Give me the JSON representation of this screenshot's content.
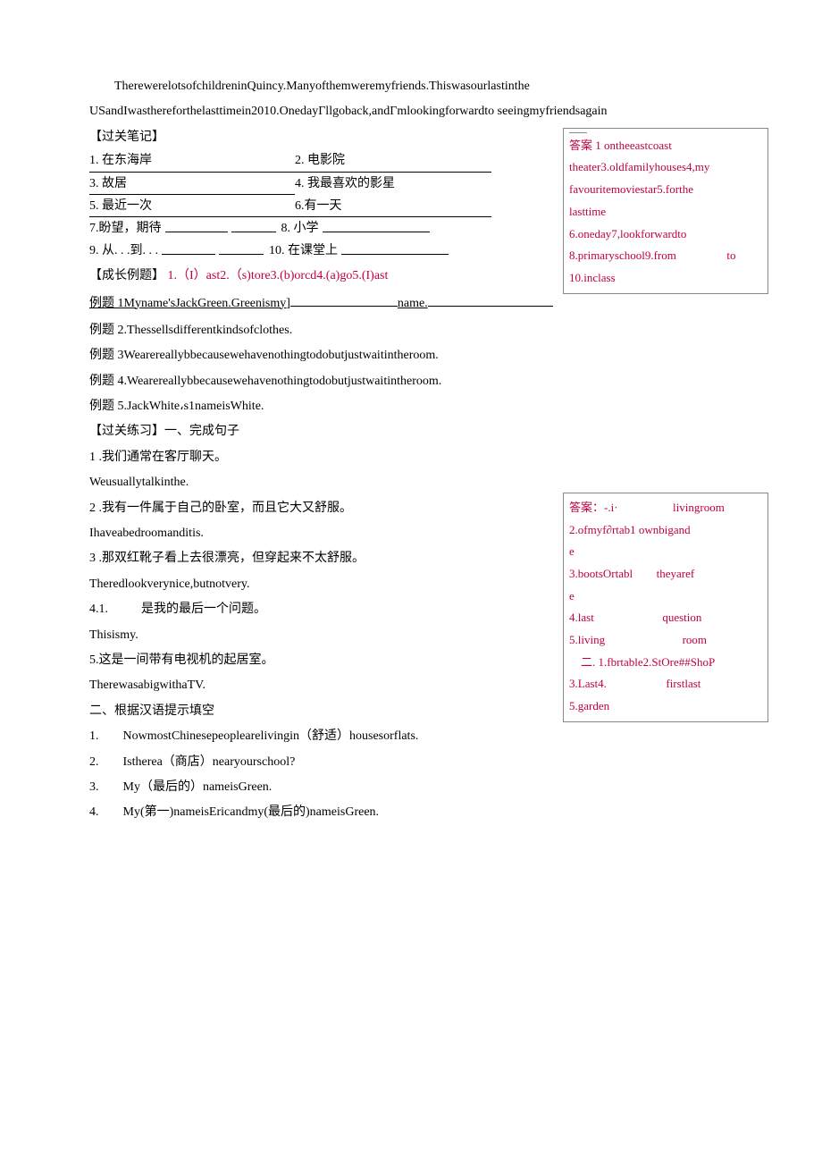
{
  "intro": {
    "p1": "TherewerelotsofchildreninQuincy.Manyofthemweremyfriends.Thiswasourlastinthe",
    "p2": "USandIwasthereforthelasttimein2010.OnedayΓllgoback,andΓmlookingforwardto seeingmyfriendsagain"
  },
  "notes_title": "【过关笔记】",
  "vocab": {
    "r1a": "1. 在东海岸",
    "r1b": "2. 电影院",
    "r2a": "3. 故居",
    "r2b": "4. 我最喜欢的影星",
    "r3a": "5. 最近一次",
    "r3b": "6.有一天",
    "r4a": "7.盼望，期待",
    "r4b": "8. 小学",
    "r5a": "9. 从. . .到. . .",
    "r5b": "10. 在课堂上"
  },
  "answers1": {
    "l1": "答案 1 ontheeastcoast",
    "l2": "theater3.oldfamilyhouses4,my",
    "l3": "favouritemoviestar5.forthe",
    "l4": "lasttime",
    "l5": "6.oneday7,lookforwardto",
    "l6a": "8.primaryschool9.from",
    "l6b": "to",
    "l7": "10.inclass"
  },
  "growth_label": "【成长例题】",
  "growth_red": "1.（I）ast2.（s)tore3.(b)orcd4.(a)go5.(I)ast",
  "ex1a": "例题 1Myname'sJackGreen.Greenismy]",
  "ex1b": "name.",
  "ex2": "例题 2.Thessellsdifferentkindsofclothes.",
  "ex3": "例题 3Wearereallybbecausewehavenothingtodobutjustwaitintheroom.",
  "ex4": "例题 4.Wearereallybbecausewehavenothingtodobutjustwaitintheroom.",
  "ex5": "例题 5.JackWhite،s1nameisWhite.",
  "practice_title": "【过关练习】一、完成句子",
  "q1": "1 .我们通常在客厅聊天。",
  "a1": "Weusuallytalkinthe.",
  "q2": "2 .我有一件属于自己的卧室，而且它大又舒服。",
  "a2": "Ihaveabedroomanditis.",
  "q3": "3 .那双红靴子看上去很漂亮，但穿起来不太舒服。",
  "a3": "Theredlookverynice,butnotvery.",
  "q4a": "4.1.",
  "q4b": "是我的最后一个问题。",
  "a4": "Thisismy.",
  "q5": "5.这是一间带有电视机的起居室。",
  "a5": "TherewasabigwithaTV.",
  "part2_title": "二、根据汉语提示填空",
  "p2_1a": "1.",
  "p2_1b": "NowmostChinesepeoplearelivingin（舒适）housesorflats.",
  "p2_2a": "2.",
  "p2_2b": "Istherea（商店）nearyourschool?",
  "p2_3a": "3.",
  "p2_3b": "My（最后的）nameisGreen.",
  "p2_4a": "4.",
  "p2_4b": "My(第一)nameisEricandmy(最后的)nameisGreen.",
  "answers2": {
    "l1a": "答案：-.i·",
    "l1b": "livingroom",
    "l2": " 2.ofmyf∂rtab1 ownbigand",
    "l3": "e",
    "l4a": " 3.bootsOrtabl",
    "l4b": "theyaref",
    "l5": "e",
    "l6a": "4.last",
    "l6b": "question",
    "l7a": "5.living",
    "l7b": "room",
    "l8": "    二. 1.fbrtable2.StOre##ShoP",
    "l9a": "3.Last4.",
    "l9b": "firstlast",
    "l10": "5.garden"
  }
}
